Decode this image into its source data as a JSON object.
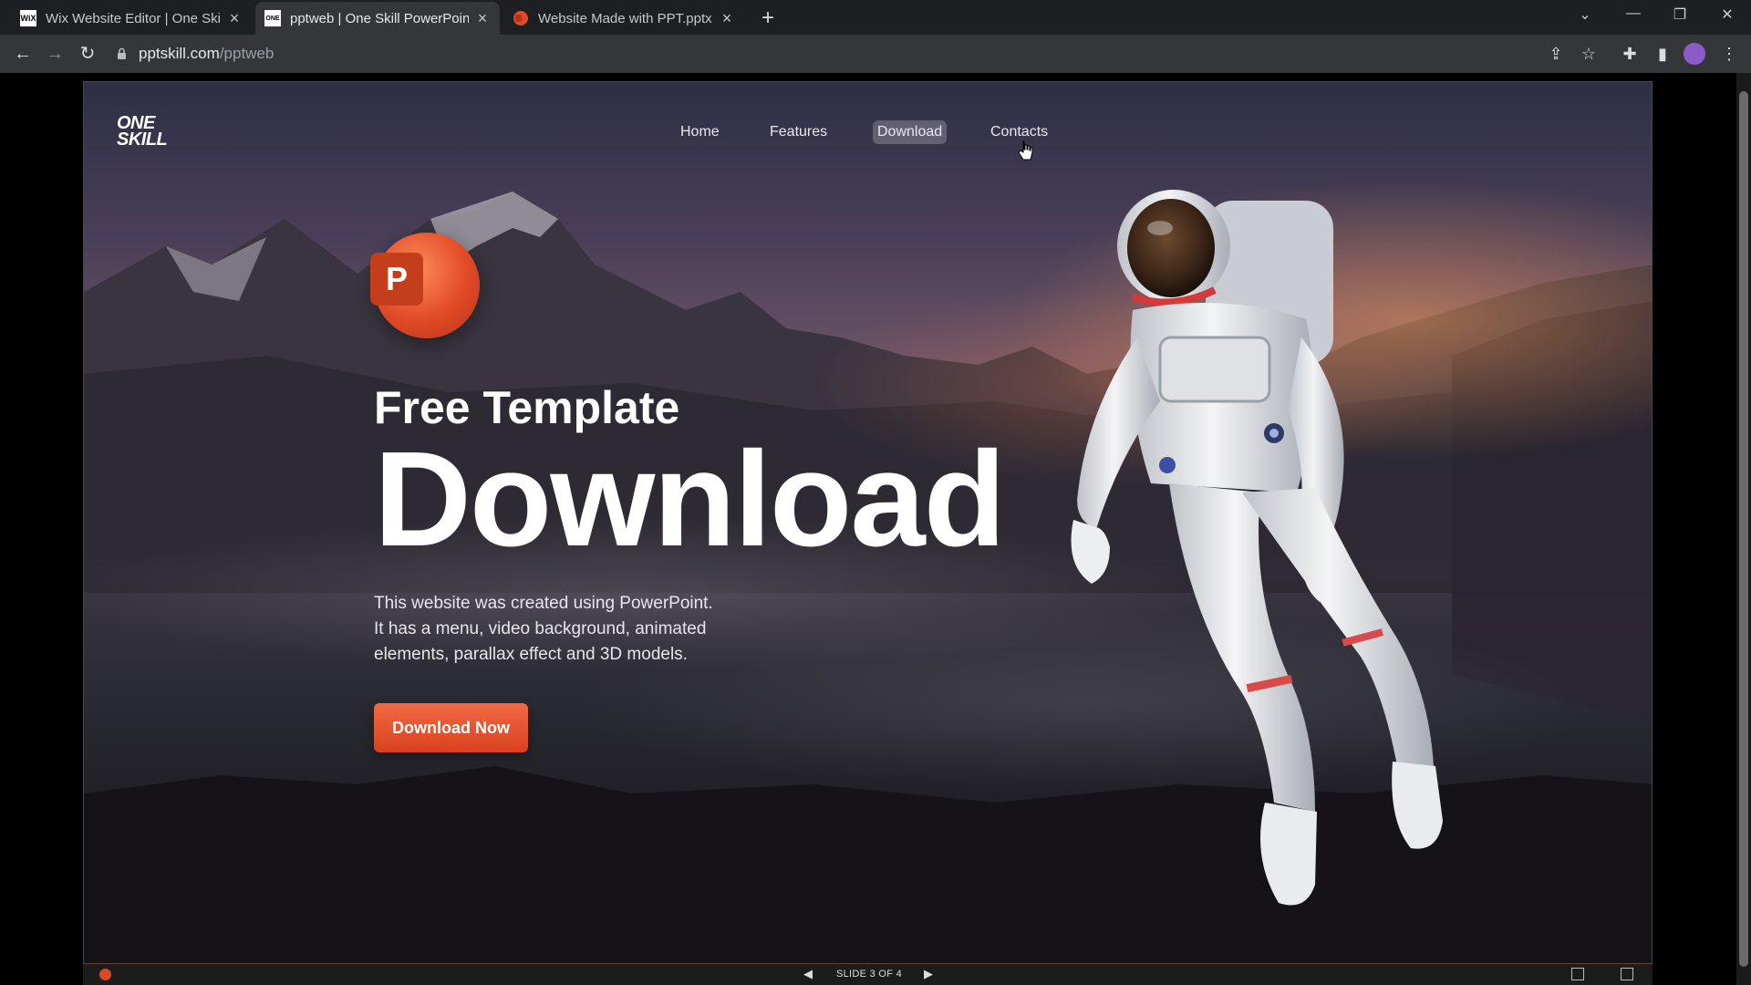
{
  "browser": {
    "tabs": [
      {
        "label": "Wix Website Editor | One Skill Po",
        "favicon": "WiX",
        "active": false
      },
      {
        "label": "pptweb | One Skill PowerPoint",
        "favicon": "ONE",
        "active": true
      },
      {
        "label": "Website Made with PPT.pptx - M",
        "favicon": "ppt",
        "active": false
      }
    ],
    "url_host": "pptskill.com",
    "url_path": "/pptweb"
  },
  "site": {
    "logo_line1": "ONE",
    "logo_line2": "SKILL",
    "nav": [
      "Home",
      "Features",
      "Download",
      "Contacts"
    ],
    "active_nav": "Download",
    "ppt_letter": "P",
    "subtitle": "Free Template",
    "headline": "Download",
    "description_lines": [
      "This website was created using PowerPoint.",
      "It has a menu, video background, animated",
      "elements, parallax effect and 3D models."
    ],
    "cta_label": "Download Now"
  },
  "statusbar": {
    "slide_label": "SLIDE 3 OF 4"
  },
  "colors": {
    "accent": "#e8542f",
    "tabbar_bg": "#1e1f22",
    "toolbar_bg": "#35363a"
  }
}
